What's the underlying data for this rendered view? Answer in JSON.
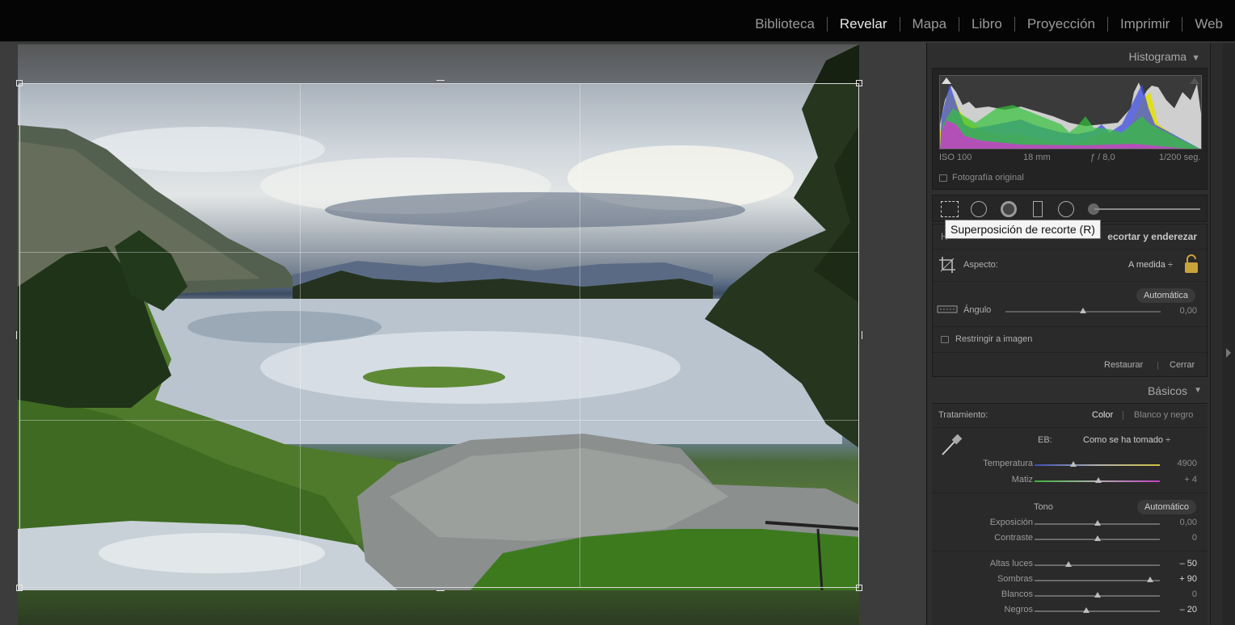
{
  "modules": [
    "Biblioteca",
    "Revelar",
    "Mapa",
    "Libro",
    "Proyección",
    "Imprimir",
    "Web"
  ],
  "active_module": "Revelar",
  "histogram": {
    "title": "Histograma",
    "iso": "ISO 100",
    "focal": "18 mm",
    "aperture": "ƒ / 8,0",
    "shutter": "1/200 seg.",
    "original_label": "Fotografía original"
  },
  "tooltip": "Superposición de recorte (R)",
  "crop": {
    "header": "Recortar y enderezar",
    "header_visible": "ecortar y enderezar",
    "aspect_label": "Aspecto:",
    "aspect_value": "A medida ÷",
    "auto_label": "Automática",
    "angle_label": "Ángulo",
    "angle_value": "0,00",
    "angle_level": 0.5,
    "constrain_label": "Restringir a imagen",
    "reset_label": "Restaurar",
    "close_label": "Cerrar"
  },
  "basics": {
    "title": "Básicos",
    "treatment_label": "Tratamiento:",
    "color_label": "Color",
    "bw_label": "Blanco y negro",
    "wb_label": "EB:",
    "wb_value": "Como se ha tomado ÷",
    "tone_label": "Tono",
    "tone_auto": "Automático",
    "sliders": [
      {
        "label": "Temperatura",
        "value": "4900",
        "level": 0.31
      },
      {
        "label": "Matiz",
        "value": "+ 4",
        "level": 0.51
      },
      {
        "label": "Exposición",
        "value": "0,00",
        "level": 0.5
      },
      {
        "label": "Contraste",
        "value": "0",
        "level": 0.5
      },
      {
        "label": "Altas luces",
        "value": "– 50",
        "level": 0.27
      },
      {
        "label": "Sombras",
        "value": "+ 90",
        "level": 0.92
      },
      {
        "label": "Blancos",
        "value": "0",
        "level": 0.5
      },
      {
        "label": "Negros",
        "value": "– 20",
        "level": 0.41
      }
    ]
  }
}
